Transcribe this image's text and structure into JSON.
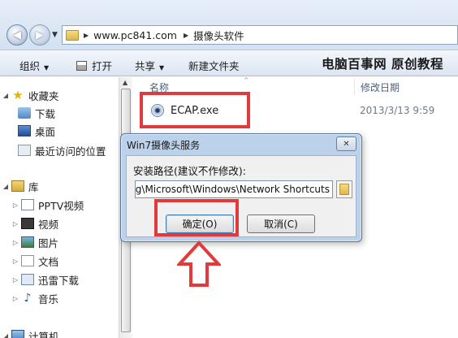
{
  "address_bar": {
    "crumbs": [
      "www.pc841.com",
      "摄像头软件"
    ]
  },
  "toolbar": {
    "organize_label": "组织",
    "open_label": "打开",
    "share_label": "共享",
    "new_folder_label": "新建文件夹"
  },
  "watermark": "电脑百事网 原创教程",
  "nav": {
    "favorites_label": "收藏夹",
    "downloads_label": "下载",
    "desktop_label": "桌面",
    "recent_label": "最近访问的位置",
    "libraries_label": "库",
    "pptv_label": "PPTV视频",
    "videos_label": "视频",
    "pictures_label": "图片",
    "documents_label": "文档",
    "xunlei_label": "迅雷下载",
    "music_label": "音乐",
    "computer_label": "计算机"
  },
  "file_list": {
    "col_name": "名称",
    "col_modified": "修改日期",
    "file": {
      "name": "ECAP.exe",
      "modified": "2013/3/13 9:59"
    }
  },
  "dialog": {
    "title": "Win7摄像头服务",
    "install_path_label": "安装路径(建议不作修改):",
    "install_path_value": "ing\\Microsoft\\Windows\\Network Shortcuts",
    "ok_label": "确定(O)",
    "cancel_label": "取消(C)"
  },
  "colors": {
    "highlight": "#e23a3a",
    "dialog_frame": "#bcd1ea"
  }
}
